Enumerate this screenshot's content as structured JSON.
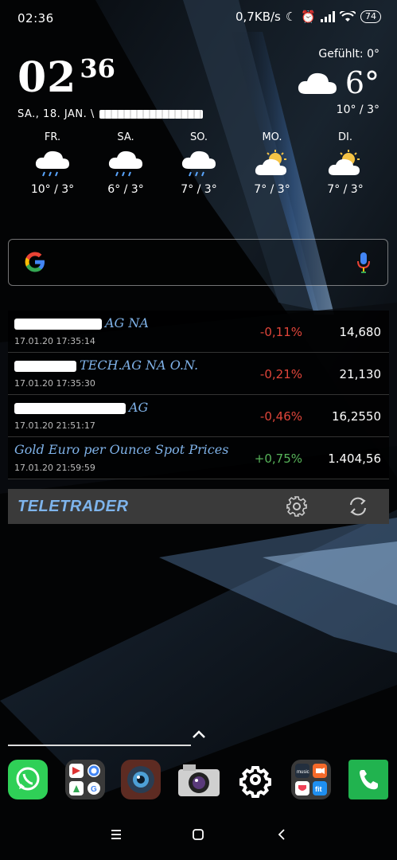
{
  "status": {
    "time": "02:36",
    "net_speed": "0,7KB/s",
    "battery": "74"
  },
  "clock": {
    "hour": "02",
    "minute": "36",
    "date": "SA., 18. JAN. \\"
  },
  "weather": {
    "feels_like": "Gefühlt: 0°",
    "current_temp": "6°",
    "current_range": "10° / 3°",
    "forecast": [
      {
        "day": "FR.",
        "icon": "rain-cloud-icon",
        "range": "10° / 3°"
      },
      {
        "day": "SA.",
        "icon": "rain-cloud-icon",
        "range": "6° / 3°"
      },
      {
        "day": "SO.",
        "icon": "rain-cloud-icon",
        "range": "7° / 3°"
      },
      {
        "day": "MO.",
        "icon": "partly-sunny-icon",
        "range": "7° / 3°"
      },
      {
        "day": "DI.",
        "icon": "partly-sunny-icon",
        "range": "7° / 3°"
      }
    ]
  },
  "stocks": [
    {
      "name": "AG NA",
      "time": "17.01.20 17:35:14",
      "change": "-0,11%",
      "price": "14,680",
      "direction": "down"
    },
    {
      "name": "TECH.AG NA O.N.",
      "time": "17.01.20 17:35:30",
      "change": "-0,21%",
      "price": "21,130",
      "direction": "down"
    },
    {
      "name": "AG",
      "time": "17.01.20 21:51:17",
      "change": "-0,46%",
      "price": "16,2550",
      "direction": "down"
    },
    {
      "name": "Gold Euro per Ounce Spot Prices",
      "time": "17.01.20 21:59:59",
      "change": "+0,75%",
      "price": "1.404,56",
      "direction": "up"
    }
  ],
  "teletrader": {
    "logo": "TELETRADER"
  },
  "dock": {
    "apps": [
      "WhatsApp",
      "Google folder",
      "Camera lens app",
      "Camera",
      "Settings",
      "Media folder",
      "Phone"
    ]
  },
  "colors": {
    "accent_blue": "#7fb2e8",
    "negative": "#e0453a",
    "positive": "#57b45a"
  }
}
